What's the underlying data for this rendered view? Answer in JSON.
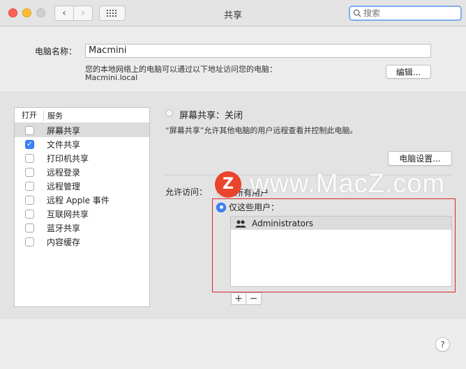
{
  "window": {
    "title": "共享",
    "search_placeholder": "搜索"
  },
  "computer": {
    "name_label": "电脑名称：",
    "name_value": "Macmini",
    "address_desc": "您的本地网络上的电脑可以通过以下地址访问您的电脑：",
    "address_host": "Macmini.local",
    "edit_label": "编辑..."
  },
  "services": {
    "col_on": "打开",
    "col_service": "服务",
    "items": [
      {
        "label": "屏幕共享",
        "checked": false,
        "selected": true
      },
      {
        "label": "文件共享",
        "checked": true,
        "selected": false
      },
      {
        "label": "打印机共享",
        "checked": false,
        "selected": false
      },
      {
        "label": "远程登录",
        "checked": false,
        "selected": false
      },
      {
        "label": "远程管理",
        "checked": false,
        "selected": false
      },
      {
        "label": "远程 Apple 事件",
        "checked": false,
        "selected": false
      },
      {
        "label": "互联网共享",
        "checked": false,
        "selected": false
      },
      {
        "label": "蓝牙共享",
        "checked": false,
        "selected": false
      },
      {
        "label": "内容缓存",
        "checked": false,
        "selected": false
      }
    ]
  },
  "detail": {
    "status": "屏幕共享：关闭",
    "description": "“屏幕共享”允许其他电脑的用户远程查看并控制此电脑。",
    "settings_label": "电脑设置...",
    "access_label": "允许访问：",
    "option_all": "所有用户",
    "option_only": "仅这些用户：",
    "users": [
      "Administrators"
    ],
    "add_label": "+",
    "remove_label": "−"
  },
  "help_label": "?",
  "watermark": {
    "logo": "Z",
    "text": "www.MacZ.com"
  },
  "colors": {
    "accent": "#3c82f7",
    "highlight_box": "#d8262c"
  }
}
